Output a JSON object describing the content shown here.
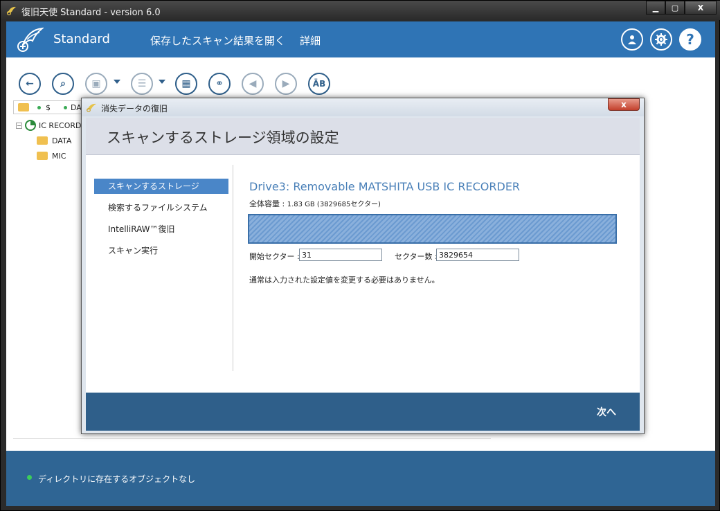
{
  "window": {
    "title": "復旧天使 Standard - version 6.0",
    "minimize": "▁",
    "maximize": "▢",
    "close": "X"
  },
  "header": {
    "brand": "Standard",
    "nav": [
      "保存したスキャン結果を開く",
      "詳細"
    ],
    "account_icon": "user-icon",
    "settings_icon": "gear-icon",
    "help_label": "?"
  },
  "toolbar": {
    "buttons": [
      {
        "name": "back",
        "glyph": "←"
      },
      {
        "name": "search",
        "glyph": "⌕"
      },
      {
        "name": "save",
        "glyph": "▣"
      },
      {
        "name": "list",
        "glyph": "☰"
      },
      {
        "name": "view",
        "glyph": "▦"
      },
      {
        "name": "find",
        "glyph": "⚭"
      },
      {
        "name": "prev",
        "glyph": "◀"
      },
      {
        "name": "next",
        "glyph": "▶"
      },
      {
        "name": "encoding",
        "glyph": "ÄB"
      }
    ]
  },
  "pathbar": {
    "segments": [
      "$",
      "DATA"
    ]
  },
  "tree": {
    "root": "IC RECORDER",
    "children": [
      "DATA",
      "MIC"
    ]
  },
  "status": {
    "text": "ディレクトリに存在するオブジェクトなし"
  },
  "dialog": {
    "title": "消失データの復旧",
    "close": "x",
    "heading": "スキャンするストレージ領域の設定",
    "steps": [
      "スキャンするストレージ",
      "検索するファイルシステム",
      "IntelliRAW™復旧",
      "スキャン実行"
    ],
    "active_step": 0,
    "drive_title": "Drive3: Removable MATSHITA USB IC RECORDER",
    "capacity_label": "全体容量 : ",
    "capacity_value": "1.83 GB (3829685セクター)",
    "start_sector_label": "開始セクター :",
    "start_sector_value": "31",
    "sector_count_label": "セクター数 :",
    "sector_count_value": "3829654",
    "note": "通常は入力された設定値を変更する必要はありません。",
    "next_button": "次へ"
  }
}
